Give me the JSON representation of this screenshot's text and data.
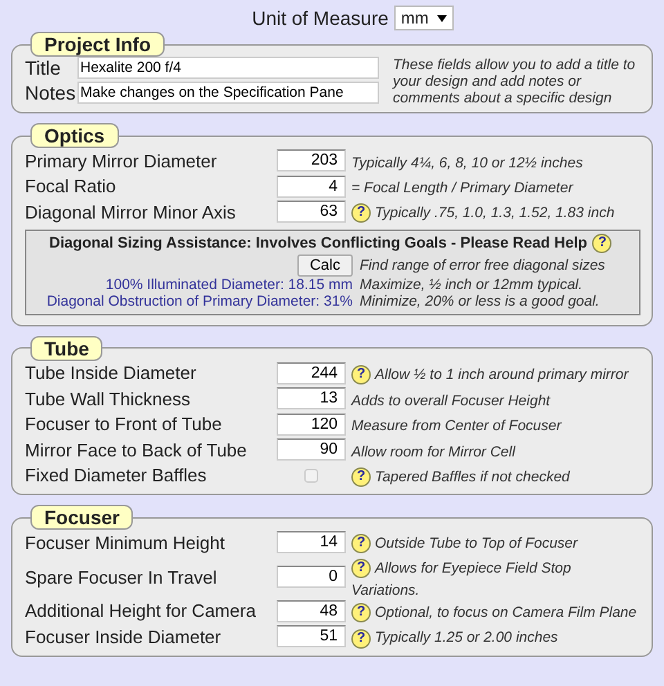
{
  "unit": {
    "label": "Unit of Measure",
    "value": "mm"
  },
  "project_info": {
    "title": "Project Info",
    "fields": [
      {
        "label": "Title",
        "value": "Hexalite 200 f/4"
      },
      {
        "label": "Notes",
        "value": "Make changes on the Specification Pane"
      }
    ],
    "note": "These fields allow you to add a title to your design and add notes or comments about a specific design"
  },
  "sections": [
    {
      "title": "Optics",
      "rows": [
        {
          "kind": "number",
          "label": "Primary Mirror Diameter",
          "value": "203",
          "hint": "Typically 4¼, 6, 8, 10 or 12½ inches"
        },
        {
          "kind": "number",
          "label": "Focal Ratio",
          "value": "4",
          "hint": "= Focal Length / Primary Diameter"
        },
        {
          "kind": "number",
          "label": "Diagonal Mirror Minor Axis",
          "value": "63",
          "help": "?",
          "hint": "Typically .75, 1.0, 1.3, 1.52, 1.83 inch"
        }
      ],
      "assist": {
        "title": "Diagonal Sizing Assistance: Involves Conflicting Goals - Please Read Help",
        "help": "?",
        "button": "Calc",
        "button_hint": "Find range of error free diagonal sizes",
        "results": [
          {
            "label": "100% Illuminated Diameter: 18.15 mm",
            "hint": "Maximize, ½ inch or 12mm typical."
          },
          {
            "label": "Diagonal Obstruction of Primary Diameter: 31%",
            "hint": "Minimize, 20% or less is a good goal."
          }
        ]
      }
    },
    {
      "title": "Tube",
      "rows": [
        {
          "kind": "number",
          "label": "Tube Inside Diameter",
          "value": "244",
          "help": "?",
          "hint": "Allow ½ to 1 inch around primary mirror"
        },
        {
          "kind": "number",
          "label": "Tube Wall Thickness",
          "value": "13",
          "hint": "Adds to overall Focuser Height"
        },
        {
          "kind": "number",
          "label": "Focuser to Front of Tube",
          "value": "120",
          "hint": "Measure from Center of Focuser"
        },
        {
          "kind": "number",
          "label": "Mirror Face to Back of Tube",
          "value": "90",
          "hint": "Allow room for Mirror Cell"
        },
        {
          "kind": "checkbox",
          "label": "Fixed Diameter Baffles",
          "checked": false,
          "help": "?",
          "hint": "Tapered Baffles if not checked"
        }
      ]
    },
    {
      "title": "Focuser",
      "rows": [
        {
          "kind": "number",
          "label": "Focuser Minimum Height",
          "value": "14",
          "help": "?",
          "hint": "Outside Tube to Top of Focuser"
        },
        {
          "kind": "number",
          "label": "Spare Focuser In Travel",
          "value": "0",
          "help": "?",
          "hint": "Allows for Eyepiece Field Stop Variations."
        },
        {
          "kind": "number",
          "label": "Additional Height for Camera",
          "value": "48",
          "help": "?",
          "hint": "Optional, to focus on Camera Film Plane"
        },
        {
          "kind": "number",
          "label": "Focuser Inside Diameter",
          "value": "51",
          "help": "?",
          "hint": "Typically 1.25 or 2.00 inches"
        }
      ]
    }
  ]
}
